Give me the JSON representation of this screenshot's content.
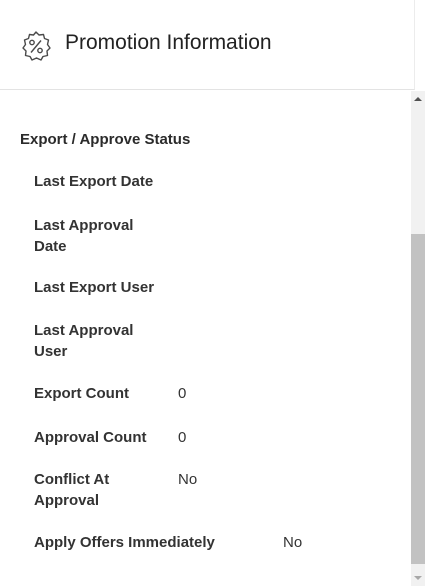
{
  "header": {
    "title": "Promotion Information",
    "icon": "percent-badge-icon"
  },
  "section": {
    "title": "Export / Approve Status"
  },
  "rows": [
    {
      "label": "Last Export Date",
      "value": ""
    },
    {
      "label": "Last Approval Date",
      "value": ""
    },
    {
      "label": "Last Export User",
      "value": ""
    },
    {
      "label": "Last Approval User",
      "value": ""
    },
    {
      "label": "Export Count",
      "value": "0"
    },
    {
      "label": "Approval Count",
      "value": "0"
    },
    {
      "label": "Conflict At Approval",
      "value": "No"
    },
    {
      "label": "Apply Offers Immediately",
      "value": "No"
    }
  ],
  "colors": {
    "scroll_thumb": "#c2c2c2",
    "scroll_track": "#f1f1f1"
  }
}
